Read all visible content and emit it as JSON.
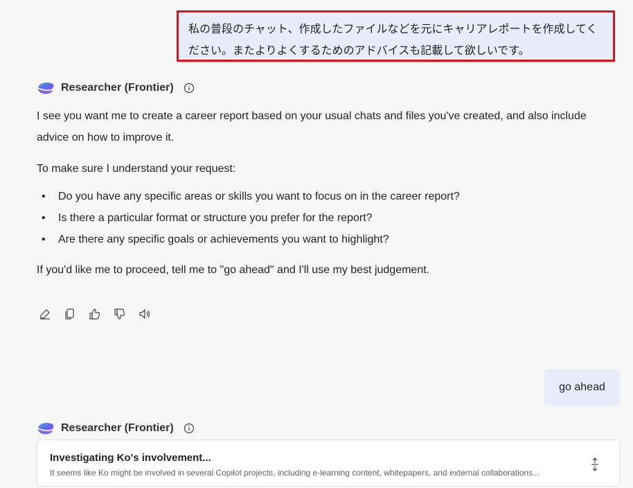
{
  "conversation": {
    "user_message_1": "私の普段のチャット、作成したファイルなどを元にキャリアレポートを作成してください。またよりよくするためのアドバイスも記載して欲しいです。",
    "agent_name": "Researcher (Frontier)",
    "agent_reply": {
      "intro": "I see you want me to create a career report based on your usual chats and files you've created, and also include advice on how to improve it.",
      "lead": "To make sure I understand your request:",
      "questions": [
        "Do you have any specific areas or skills you want to focus on in the career report?",
        "Is there a particular format or structure you prefer for the report?",
        "Are there any specific goals or achievements you want to highlight?"
      ],
      "closing": "If you'd like me to proceed, tell me to \"go ahead\" and I'll use my best judgement."
    },
    "actions": [
      "edit-icon",
      "copy-icon",
      "thumbs-up-icon",
      "thumbs-down-icon",
      "speaker-icon"
    ],
    "user_message_2": "go ahead",
    "agent_name_2": "Researcher (Frontier)",
    "research_card": {
      "title": "Investigating Ko's involvement...",
      "subtitle": "It seems like Ko might be involved in several Copilot projects, including e-learning content, whitepapers, and external collaborations..."
    }
  },
  "colors": {
    "user_bubble": "#e8ebfa",
    "highlight_border": "#e0101a",
    "background": "#f6f6f7"
  }
}
